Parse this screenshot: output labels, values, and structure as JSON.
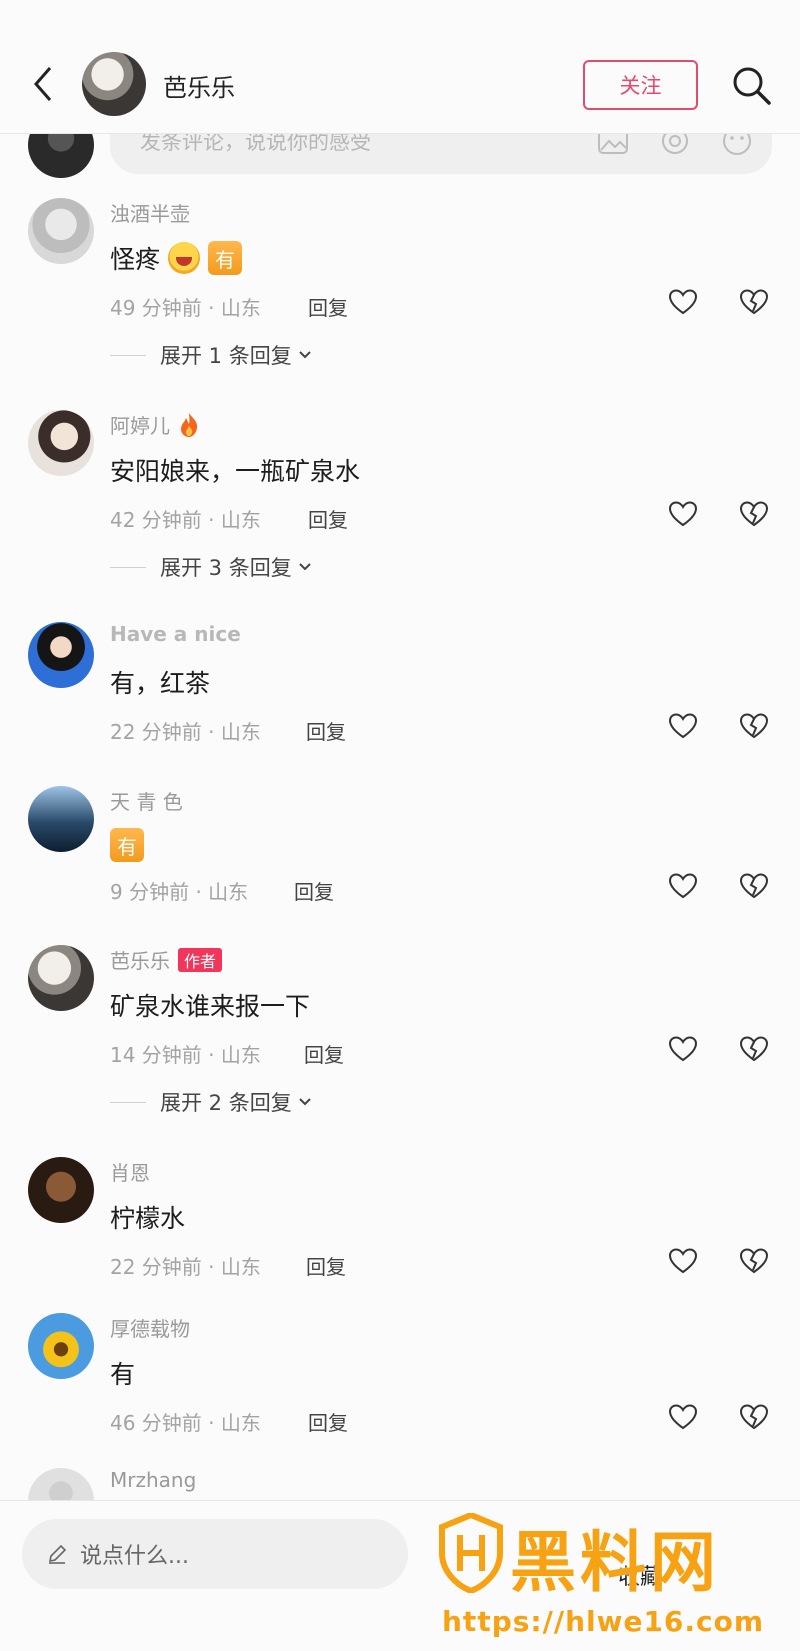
{
  "header": {
    "title": "芭乐乐",
    "follow_label": "关注"
  },
  "top_input": {
    "placeholder": "发条评论，说说你的感受"
  },
  "comments": [
    {
      "user": "浊酒半壶",
      "text": "怪疼",
      "emoji": "grin-scream-emoji",
      "badge": "有",
      "meta": "49 分钟前 · 山东",
      "reply": "回复",
      "expand": "展开 1 条回复"
    },
    {
      "user": "阿婷儿",
      "user_icon": "fire-icon",
      "text": "安阳娘来，一瓶矿泉水",
      "meta": "42 分钟前 · 山东",
      "reply": "回复",
      "expand": "展开 3 条回复"
    },
    {
      "user": "Have a nice",
      "text": "有，红茶",
      "meta": "22 分钟前 · 山东",
      "reply": "回复"
    },
    {
      "user": "天 青 色",
      "badge": "有",
      "meta": "9 分钟前 · 山东",
      "reply": "回复"
    },
    {
      "user": "芭乐乐",
      "tag": "作者",
      "text": "矿泉水谁来报一下",
      "meta": "14 分钟前 · 山东",
      "reply": "回复",
      "expand": "展开 2 条回复"
    },
    {
      "user": "肖恩",
      "text": "柠檬水",
      "meta": "22 分钟前 · 山东",
      "reply": "回复"
    },
    {
      "user": "厚德载物",
      "text": "有",
      "meta": "46 分钟前 · 山东",
      "reply": "回复"
    },
    {
      "user": "Mrzhang"
    }
  ],
  "bottom": {
    "say_placeholder": "说点什么...",
    "watermark_title": "黑料网",
    "watermark_url": "https://hlwe16.com",
    "partial_label": "收藏"
  },
  "colors": {
    "accent": "#e44a6b",
    "author_tag": "#f2355b",
    "watermark": "#f6a212"
  }
}
